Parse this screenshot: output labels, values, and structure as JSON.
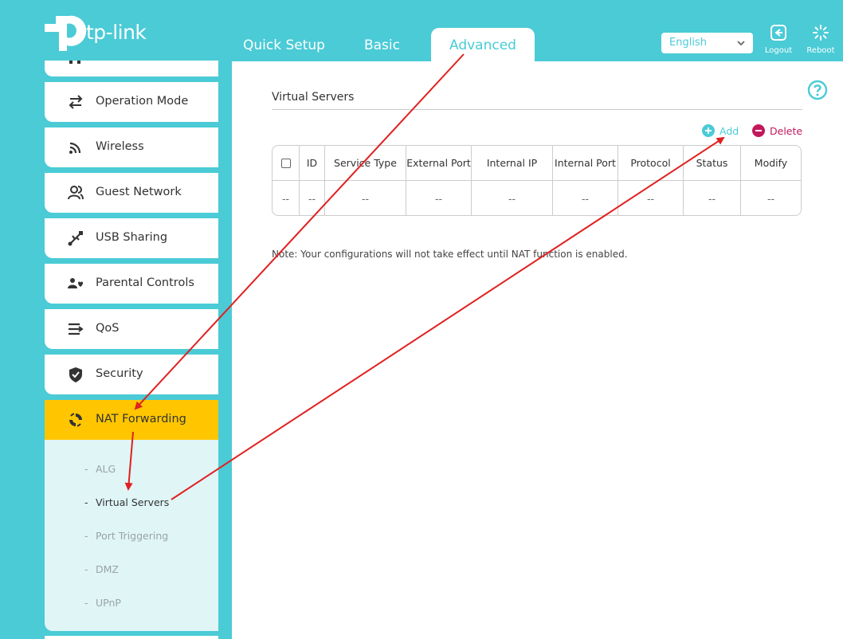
{
  "brand": {
    "name": "tp-link"
  },
  "nav": {
    "tabs": [
      {
        "label": "Quick Setup"
      },
      {
        "label": "Basic"
      },
      {
        "label": "Advanced"
      }
    ]
  },
  "header": {
    "language": "English",
    "logout_label": "Logout",
    "reboot_label": "Reboot"
  },
  "sidebar": {
    "items": [
      {
        "label": "Operation Mode",
        "icon": "operation-mode-icon"
      },
      {
        "label": "Wireless",
        "icon": "wireless-icon"
      },
      {
        "label": "Guest Network",
        "icon": "guest-network-icon"
      },
      {
        "label": "USB Sharing",
        "icon": "usb-icon"
      },
      {
        "label": "Parental Controls",
        "icon": "parental-controls-icon"
      },
      {
        "label": "QoS",
        "icon": "qos-icon"
      },
      {
        "label": "Security",
        "icon": "shield-icon"
      },
      {
        "label": "NAT Forwarding",
        "icon": "nat-forwarding-icon"
      }
    ],
    "sub_items": [
      {
        "label": "ALG"
      },
      {
        "label": "Virtual Servers"
      },
      {
        "label": "Port Triggering"
      },
      {
        "label": "DMZ"
      },
      {
        "label": "UPnP"
      }
    ]
  },
  "main": {
    "title": "Virtual Servers",
    "add_label": "Add",
    "delete_label": "Delete",
    "table": {
      "columns": [
        "ID",
        "Service Type",
        "External Port",
        "Internal IP",
        "Internal Port",
        "Protocol",
        "Status",
        "Modify"
      ],
      "empty_row": [
        "--",
        "--",
        "--",
        "--",
        "--",
        "--",
        "--",
        "--",
        "--"
      ]
    },
    "note": "Note: Your configurations will not take effect until NAT function is enabled."
  },
  "colors": {
    "accent": "#4acbd6",
    "highlight": "#ffc600",
    "delete": "#c2185b",
    "arrow": "#e02020"
  }
}
